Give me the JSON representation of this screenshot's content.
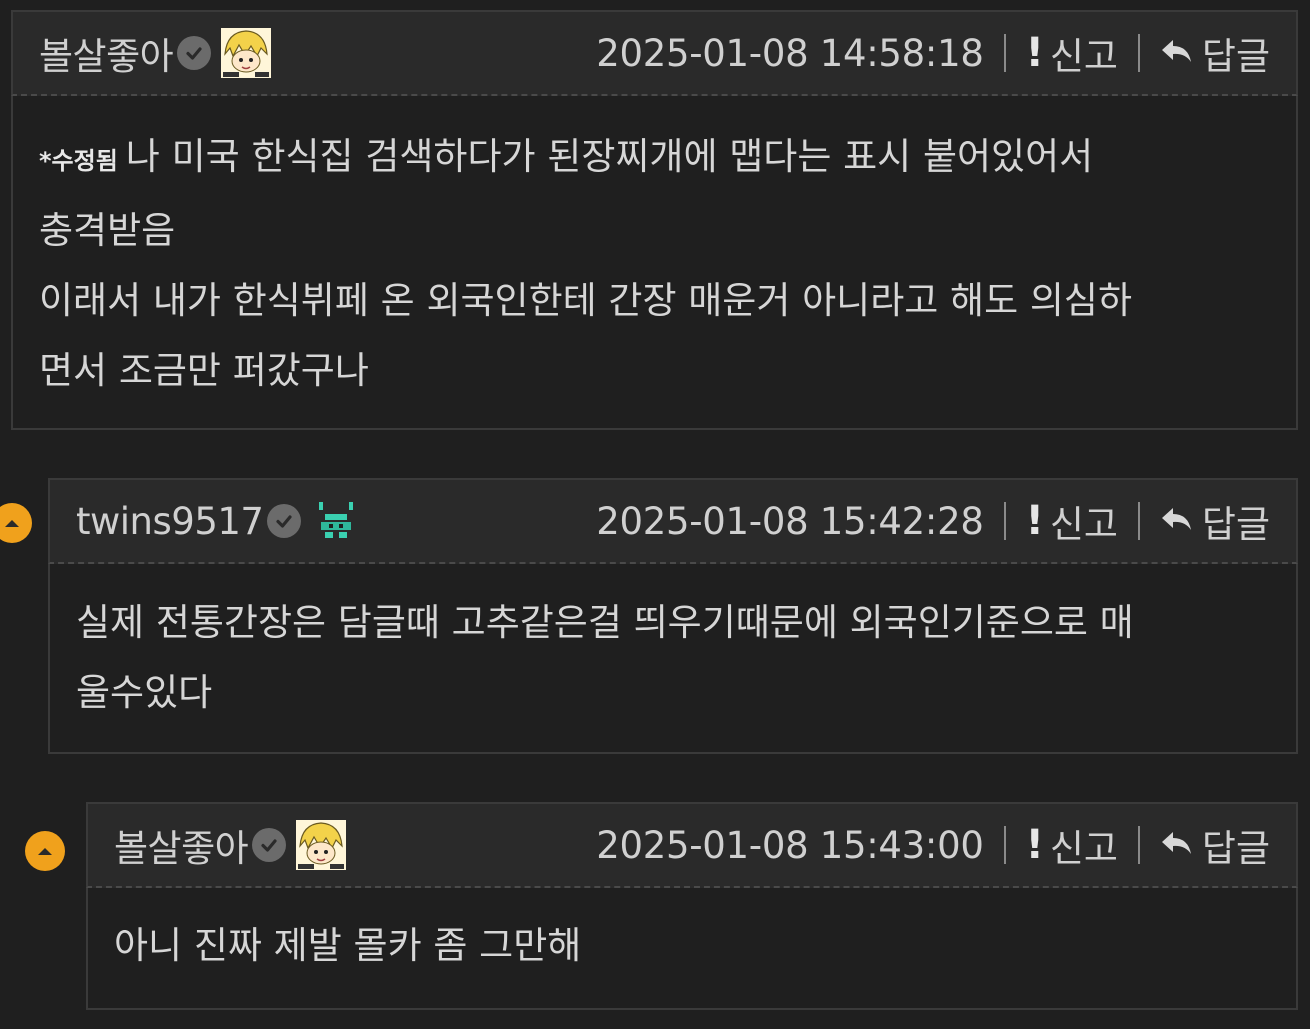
{
  "comments": [
    {
      "nickname": "볼살좋아",
      "datetime": "2025-01-08 14:58:18",
      "report_label": "신고",
      "reply_label": "답글",
      "edited_tag": "*수정됨",
      "lines": [
        "나 미국 한식집 검색하다가 된장찌개에 맵다는 표시 붙어있어서",
        "충격받음",
        "이래서 내가 한식뷔페 온 외국인한테 간장 매운거 아니라고 해도 의심하",
        "면서 조금만 퍼갔구나"
      ]
    },
    {
      "nickname": "twins9517",
      "datetime": "2025-01-08 15:42:28",
      "report_label": "신고",
      "reply_label": "답글",
      "lines": [
        "실제 전통간장은 담글때 고추같은걸 띄우기때문에 외국인기준으로 매",
        "울수있다"
      ]
    },
    {
      "nickname": "볼살좋아",
      "datetime": "2025-01-08 15:43:00",
      "report_label": "신고",
      "reply_label": "답글",
      "lines": [
        "아니 진짜 제발 몰카 좀 그만해"
      ]
    }
  ],
  "colors": {
    "background": "#1f1f1f",
    "header": "#2a2a2a",
    "thread_icon": "#f0a11c",
    "verified_badge": "#6b6b6b"
  },
  "icons": {
    "verified": "check-circle-icon",
    "report": "exclamation-icon",
    "reply": "reply-arrow-icon",
    "thread": "chevron-up-icon"
  }
}
